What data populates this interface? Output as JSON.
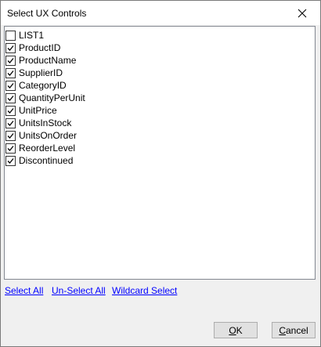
{
  "window": {
    "title": "Select UX Controls"
  },
  "list": {
    "items": [
      {
        "label": "LIST1",
        "checked": false
      },
      {
        "label": "ProductID",
        "checked": true
      },
      {
        "label": "ProductName",
        "checked": true
      },
      {
        "label": "SupplierID",
        "checked": true
      },
      {
        "label": "CategoryID",
        "checked": true
      },
      {
        "label": "QuantityPerUnit",
        "checked": true
      },
      {
        "label": "UnitPrice",
        "checked": true
      },
      {
        "label": "UnitsInStock",
        "checked": true
      },
      {
        "label": "UnitsOnOrder",
        "checked": true
      },
      {
        "label": "ReorderLevel",
        "checked": true
      },
      {
        "label": "Discontinued",
        "checked": true
      }
    ]
  },
  "links": {
    "select_all": "Select All",
    "unselect_all": "Un-Select All",
    "wildcard": "Wildcard Select"
  },
  "buttons": {
    "ok": "OK",
    "cancel": "Cancel"
  },
  "icons": {
    "close": "close-icon",
    "check": "check-icon"
  }
}
